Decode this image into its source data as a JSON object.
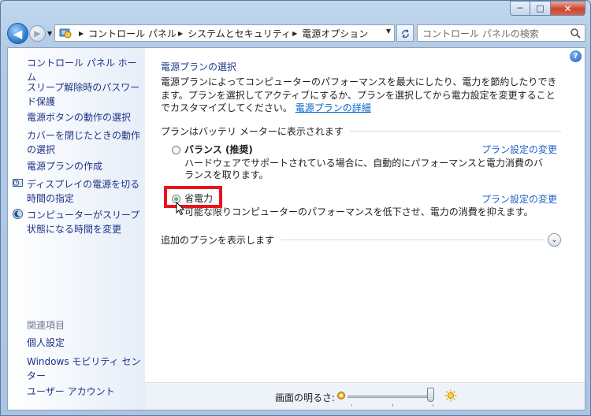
{
  "window": {
    "minimize_label": "─",
    "maximize_label": "□",
    "close_label": "✕"
  },
  "nav": {
    "back_glyph": "◀",
    "forward_glyph": "▶",
    "breadcrumb": [
      "コントロール パネル",
      "システムとセキュリティ",
      "電源オプション"
    ],
    "search_placeholder": "コントロール パネルの検索"
  },
  "sidebar": {
    "home": "コントロール パネル ホーム",
    "items": [
      "スリープ解除時のパスワード保護",
      "電源ボタンの動作の選択",
      "カバーを閉じたときの動作の選択",
      "電源プランの作成",
      "ディスプレイの電源を切る時間の指定",
      "コンピューターがスリープ状態になる時間を変更"
    ],
    "related_header": "関連項目",
    "related": [
      "個人設定",
      "Windows モビリティ センター",
      "ユーザー アカウント"
    ]
  },
  "main": {
    "help_label": "?",
    "title": "電源プランの選択",
    "description": "電源プランによってコンピューターのパフォーマンスを最大にしたり、電力を節約したりできます。プランを選択してアクティブにするか、プランを選択してから電力設定を変更することでカスタマイズしてください。",
    "details_link": "電源プランの詳細",
    "battery_section": "プランはバッテリ メーターに表示されます",
    "plans": [
      {
        "name": "バランス (推奨)",
        "link": "プラン設定の変更",
        "description": "ハードウェアでサポートされている場合に、自動的にパフォーマンスと電力消費のバランスを取ります。",
        "selected": false
      },
      {
        "name": "省電力",
        "link": "プラン設定の変更",
        "description": "可能な限りコンピューターのパフォーマンスを低下させ、電力の消費を抑えます。",
        "selected": true
      }
    ],
    "additional_plans": "追加のプランを表示します",
    "brightness_label": "画面の明るさ:",
    "brightness_level": 1.0
  },
  "colors": {
    "link": "#1d63c6",
    "sidebar_link": "#1e3287",
    "highlight": "#e8141d"
  }
}
